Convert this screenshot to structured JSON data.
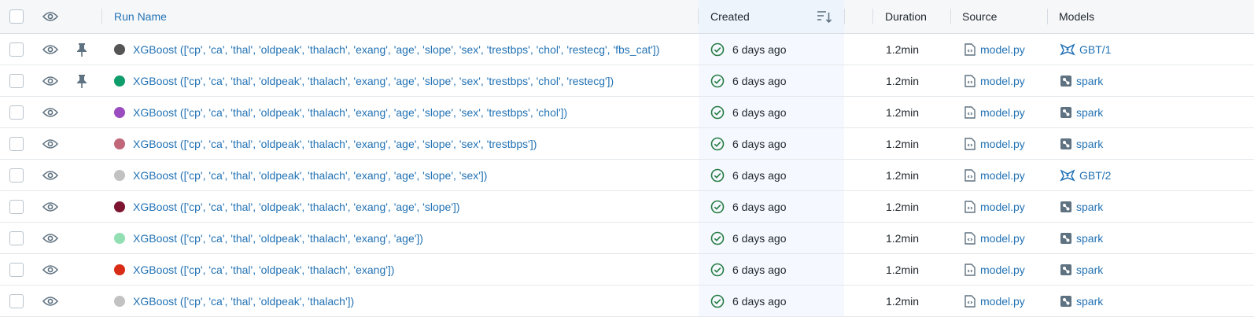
{
  "header": {
    "run_name": "Run Name",
    "created": "Created",
    "duration": "Duration",
    "source": "Source",
    "models": "Models"
  },
  "colors": {
    "link": "#2272b4",
    "success": "#277c43",
    "created_column_bg": "#f5f9ff"
  },
  "icons": {
    "visibility": "eye-icon",
    "pin": "pin-icon",
    "status": "check-circle-icon",
    "source": "notebook-file-icon",
    "registered_model": "registered-model-icon",
    "logged_model": "spark-model-icon",
    "sort": "sort-descending-icon"
  },
  "rows": [
    {
      "name": "XGBoost (['cp', 'ca', 'thal', 'oldpeak', 'thalach', 'exang', 'age', 'slope', 'sex', 'trestbps', 'chol', 'restecg', 'fbs_cat'])",
      "color": "#555555",
      "pinned": true,
      "created": "6 days ago",
      "duration": "1.2min",
      "source": "model.py",
      "model": "GBT/1",
      "model_icon": "registered-model-icon"
    },
    {
      "name": "XGBoost (['cp', 'ca', 'thal', 'oldpeak', 'thalach', 'exang', 'age', 'slope', 'sex', 'trestbps', 'chol', 'restecg'])",
      "color": "#0f9d6b",
      "pinned": true,
      "created": "6 days ago",
      "duration": "1.2min",
      "source": "model.py",
      "model": "spark",
      "model_icon": "spark-model-icon"
    },
    {
      "name": "XGBoost (['cp', 'ca', 'thal', 'oldpeak', 'thalach', 'exang', 'age', 'slope', 'sex', 'trestbps', 'chol'])",
      "color": "#9b4dbf",
      "pinned": false,
      "created": "6 days ago",
      "duration": "1.2min",
      "source": "model.py",
      "model": "spark",
      "model_icon": "spark-model-icon"
    },
    {
      "name": "XGBoost (['cp', 'ca', 'thal', 'oldpeak', 'thalach', 'exang', 'age', 'slope', 'sex', 'trestbps'])",
      "color": "#c0677a",
      "pinned": false,
      "created": "6 days ago",
      "duration": "1.2min",
      "source": "model.py",
      "model": "spark",
      "model_icon": "spark-model-icon"
    },
    {
      "name": "XGBoost (['cp', 'ca', 'thal', 'oldpeak', 'thalach', 'exang', 'age', 'slope', 'sex'])",
      "color": "#c2c2c2",
      "pinned": false,
      "created": "6 days ago",
      "duration": "1.2min",
      "source": "model.py",
      "model": "GBT/2",
      "model_icon": "registered-model-icon"
    },
    {
      "name": "XGBoost (['cp', 'ca', 'thal', 'oldpeak', 'thalach', 'exang', 'age', 'slope'])",
      "color": "#7d1531",
      "pinned": false,
      "created": "6 days ago",
      "duration": "1.2min",
      "source": "model.py",
      "model": "spark",
      "model_icon": "spark-model-icon"
    },
    {
      "name": "XGBoost (['cp', 'ca', 'thal', 'oldpeak', 'thalach', 'exang', 'age'])",
      "color": "#93dfb4",
      "pinned": false,
      "created": "6 days ago",
      "duration": "1.2min",
      "source": "model.py",
      "model": "spark",
      "model_icon": "spark-model-icon"
    },
    {
      "name": "XGBoost (['cp', 'ca', 'thal', 'oldpeak', 'thalach', 'exang'])",
      "color": "#d82c17",
      "pinned": false,
      "created": "6 days ago",
      "duration": "1.2min",
      "source": "model.py",
      "model": "spark",
      "model_icon": "spark-model-icon"
    },
    {
      "name": "XGBoost (['cp', 'ca', 'thal', 'oldpeak', 'thalach'])",
      "color": "#c2c2c2",
      "pinned": false,
      "created": "6 days ago",
      "duration": "1.2min",
      "source": "model.py",
      "model": "spark",
      "model_icon": "spark-model-icon"
    }
  ]
}
